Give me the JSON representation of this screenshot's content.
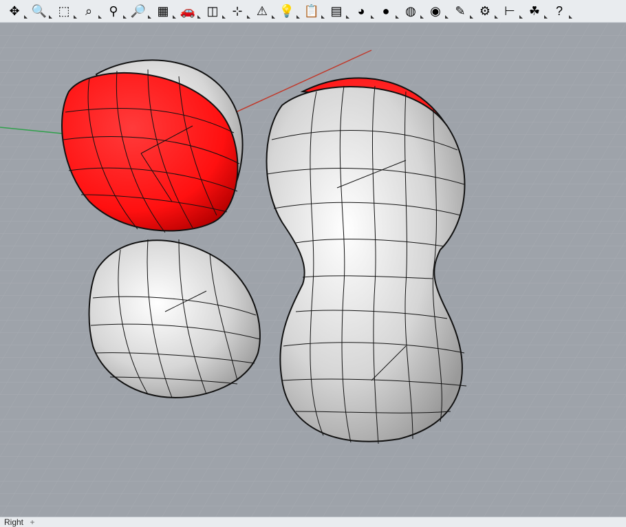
{
  "toolbar": {
    "icons": [
      "gumball-icon",
      "zoom-extents-icon",
      "zoom-window-icon",
      "zoom-selected-icon",
      "zoom-dynamic-icon",
      "zoom-target-icon",
      "four-viewports-icon",
      "car-view-icon",
      "grid-options-icon",
      "cplane-icon",
      "snap-icon",
      "light-icon",
      "clipboard-icon",
      "layers-icon",
      "color-wheel-icon",
      "shaded-sphere-icon",
      "wireframe-sphere-icon",
      "rendered-sphere-icon",
      "pen-icon",
      "gear-icon",
      "dimension-icon",
      "grasshopper-icon",
      "help-icon"
    ],
    "glyphs": [
      "✥",
      "🔍",
      "⬚",
      "⌕",
      "⚲",
      "🔎",
      "▦",
      "🚗",
      "◫",
      "⊹",
      "⚠",
      "💡",
      "📋",
      "▤",
      "◕",
      "●",
      "◍",
      "◉",
      "✎",
      "⚙",
      "⊢",
      "☘",
      "?"
    ]
  },
  "viewport": {
    "name": "Right"
  },
  "status": {
    "viewport_tab": "Right",
    "add_symbol": "+"
  },
  "colors": {
    "background": "#9ea3aa",
    "grid": "#a9adb3",
    "red_surface": "#ff1a1a",
    "grey_surface": "#e6e6e6",
    "x_axis": "#c0392b",
    "y_axis": "#2ea04a"
  }
}
